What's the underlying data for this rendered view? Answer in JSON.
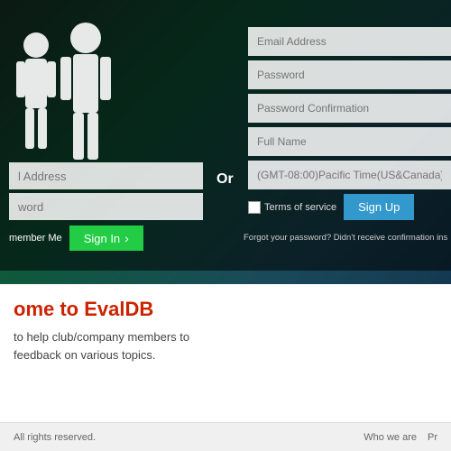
{
  "background": {
    "color_dark": "#0d2a1a",
    "color_mid": "#1a4a5a"
  },
  "left_panel": {
    "email_placeholder": "l Address",
    "password_placeholder": "word",
    "remember_me_label": "member Me",
    "signin_label": "Sign In",
    "signin_arrow": "›"
  },
  "or_divider": "Or",
  "right_panel": {
    "email_placeholder": "Email Address",
    "password_placeholder": "Password",
    "password_confirm_placeholder": "Password Confirmation",
    "fullname_placeholder": "Full Name",
    "timezone_placeholder": "(GMT-08:00)Pacific Time(US&Canada)",
    "terms_label": "Terms of service",
    "signup_label": "Sign Up"
  },
  "forgot_text": "Forgot your password? Didn't receive confirmation ins",
  "bottom": {
    "welcome_prefix": "ome to ",
    "brand": "EvalDB",
    "description_line1": "to help club/company members to",
    "description_line2": "  feedback on various topics."
  },
  "footer": {
    "copyright": "All rights reserved.",
    "link1": "Who we are",
    "link2": "Pr"
  }
}
